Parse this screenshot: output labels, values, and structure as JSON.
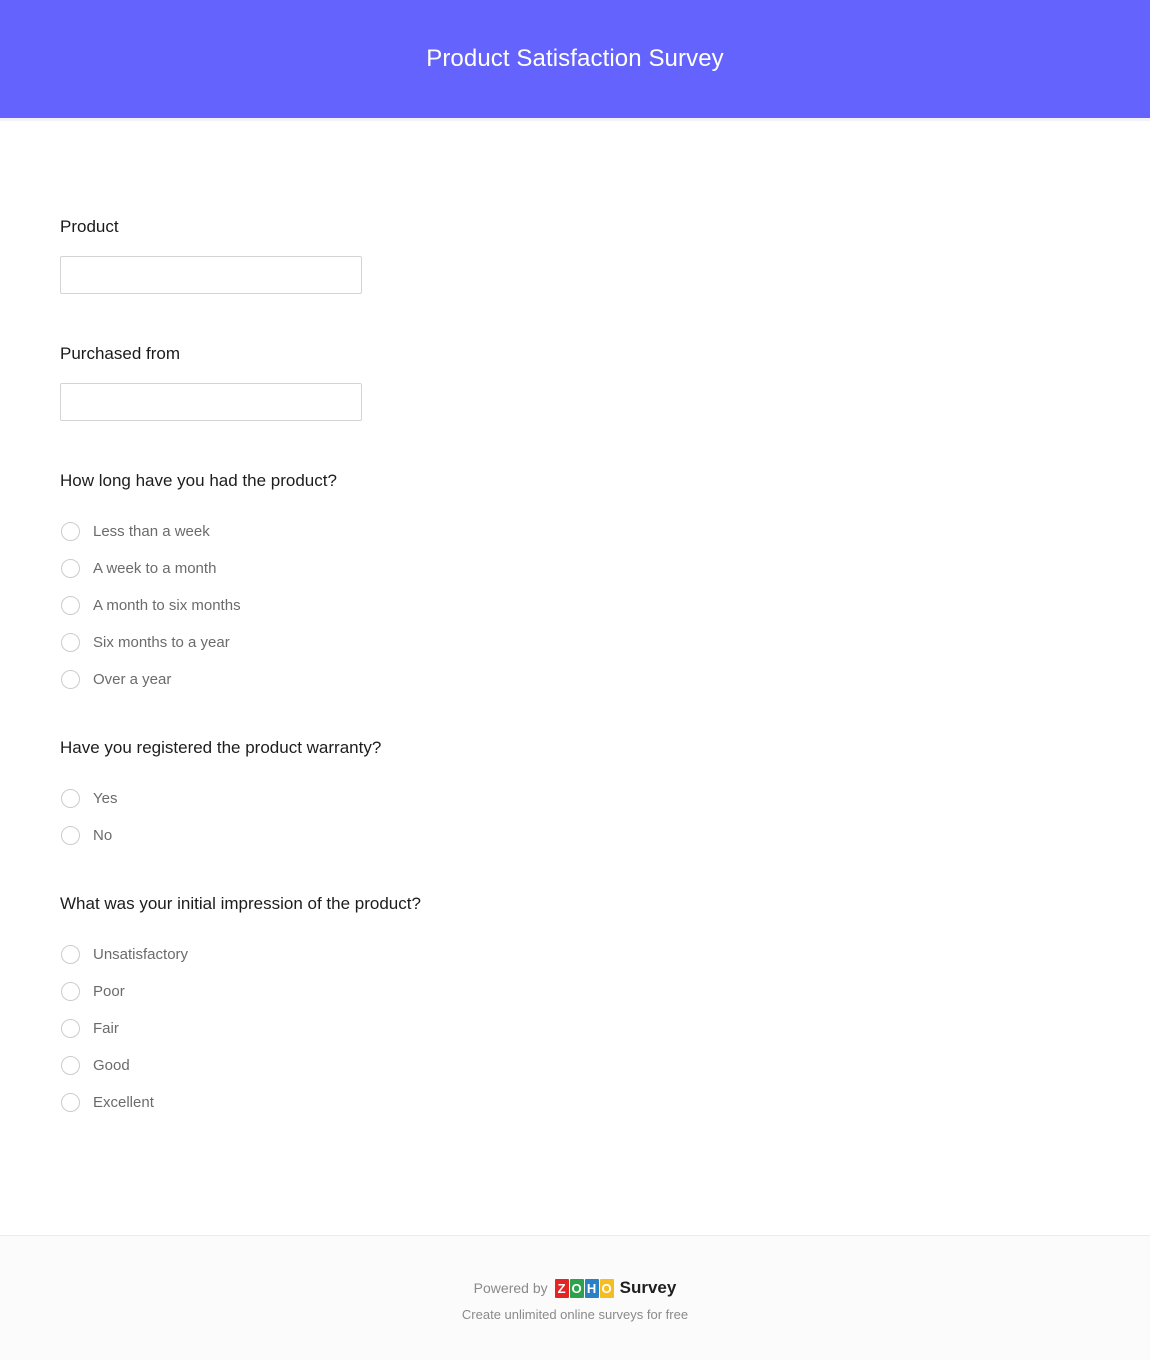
{
  "header": {
    "title": "Product Satisfaction Survey",
    "background_color": "#6563fd",
    "title_color": "#ffffff"
  },
  "form": {
    "text_fields": [
      {
        "label": "Product",
        "value": "",
        "placeholder": ""
      },
      {
        "label": "Purchased from",
        "value": "",
        "placeholder": ""
      }
    ],
    "questions": [
      {
        "title": "How long have you had the product?",
        "type": "radio",
        "selected": null,
        "options": [
          "Less than a week",
          "A week to a month",
          "A month to six months",
          "Six months to a year",
          "Over a year"
        ]
      },
      {
        "title": "Have you registered the product warranty?",
        "type": "radio",
        "selected": null,
        "options": [
          "Yes",
          "No"
        ]
      },
      {
        "title": "What was your initial impression of the product?",
        "type": "radio",
        "selected": null,
        "options": [
          "Unsatisfactory",
          "Poor",
          "Fair",
          "Good",
          "Excellent"
        ]
      }
    ]
  },
  "footer": {
    "powered_by": "Powered by",
    "brand_tiles": [
      {
        "letter": "Z",
        "color": "#e42527"
      },
      {
        "letter": "O",
        "color": "#2ca24c"
      },
      {
        "letter": "H",
        "color": "#2b7fc4"
      },
      {
        "letter": "O",
        "color": "#f5bd1f"
      }
    ],
    "product_word": "Survey",
    "tagline": "Create unlimited online surveys for free",
    "background_color": "#fafbfa"
  }
}
